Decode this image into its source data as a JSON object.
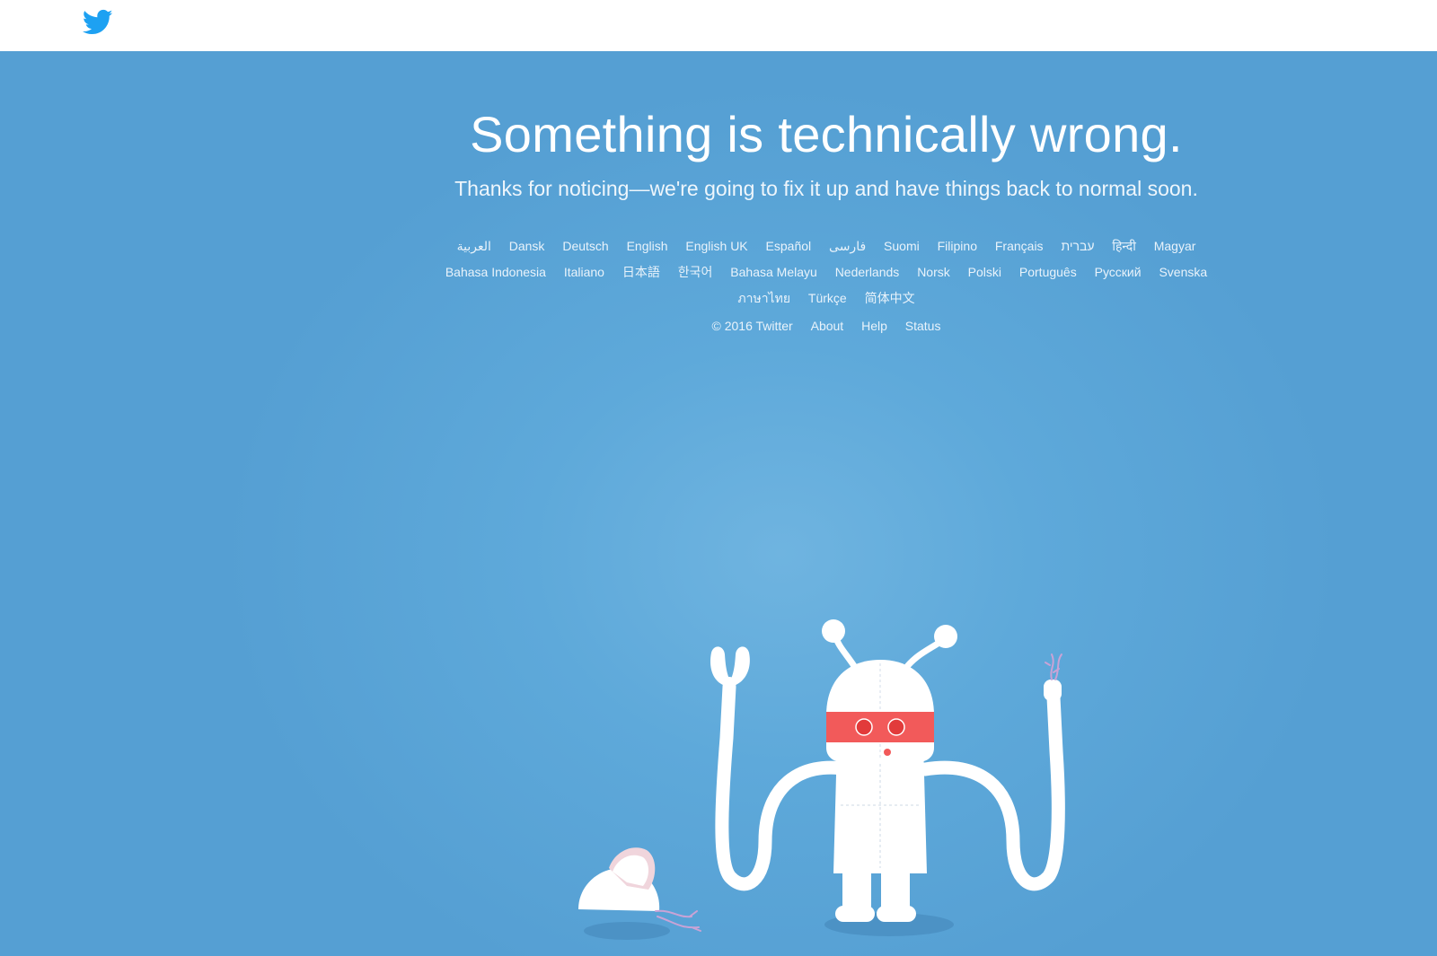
{
  "header": {
    "logo_icon": "twitter-bird-icon",
    "logo_color": "#1da1f2"
  },
  "main": {
    "title": "Something is technically wrong.",
    "subtitle": "Thanks for noticing—we're going to fix it up and have things back to normal soon.",
    "background_color": "#5aa3d6",
    "languages": [
      [
        "العربية",
        "Dansk",
        "Deutsch",
        "English",
        "English UK",
        "Español",
        "فارسی",
        "Suomi",
        "Filipino",
        "Français",
        "עברית",
        "हिन्दी",
        "Magyar"
      ],
      [
        "Bahasa Indonesia",
        "Italiano",
        "日本語",
        "한국어",
        "Bahasa Melayu",
        "Nederlands",
        "Norsk",
        "Polski",
        "Português",
        "Русский",
        "Svenska"
      ],
      [
        "ภาษาไทย",
        "Türkçe",
        "简体中文"
      ]
    ]
  },
  "footer": {
    "copyright": "© 2016 Twitter",
    "about": "About",
    "help": "Help",
    "status": "Status"
  },
  "illustration": {
    "icon": "broken-robot-illustration"
  }
}
